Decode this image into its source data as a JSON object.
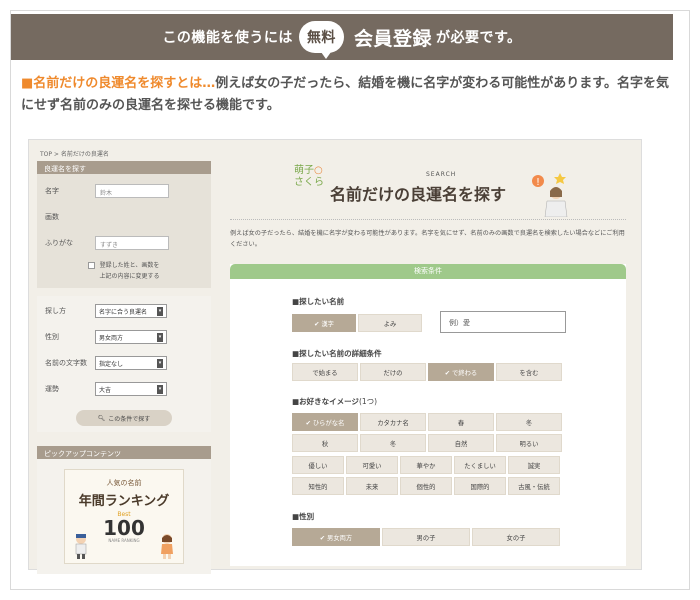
{
  "banner": {
    "prefix": "この機能を使うには",
    "bubble": "無料",
    "big": "会員登録",
    "suffix": "が必要です。"
  },
  "intro": {
    "highlight": "■名前だけの良運名を探すとは…",
    "text": "例えば女の子だったら、結婚を機に名字が変わる可能性があります。名字を気にせず名前のみの良運名を探せる機能です。"
  },
  "screenshot": {
    "breadcrumb": "TOP > 名前だけの良運名",
    "sidebar": {
      "header": "良運名を探す",
      "surname_label": "名字",
      "surname_value": "鈴木",
      "given_label": "画数",
      "kana_label": "ふりがな",
      "kana_placeholder": "すずき",
      "checkbox_text_1": "登録した姓と、画数を",
      "checkbox_text_2": "上記の内容に変更する",
      "method_label": "探し方",
      "method_value": "名字に合う良運名",
      "gender_label": "性別",
      "gender_value": "男女両方",
      "length_label": "名前の文字数",
      "length_value": "指定なし",
      "fortune_label": "運勢",
      "fortune_value": "大吉",
      "search_button": "この条件で探す",
      "pickup_header": "ピックアップコンテンツ",
      "ranking": {
        "line1": "人気の名前",
        "line2": "年間ランキング",
        "line3": "Best",
        "line4": "100",
        "line5": "NAME RANKING"
      }
    },
    "main": {
      "logo_text_1": "萌子",
      "logo_text_2": "さくら",
      "search_label": "SEARCH",
      "title": "名前だけの良運名を探す",
      "description": "例えば女の子だったら、結婚を機に名字が変わる可能性があります。名字を気にせず、名前のみの画数で良運名を検索したい場合などにご利用ください。",
      "conditions_header": "検索条件",
      "section1_title": "■探したい名前",
      "section1_options": [
        "✔ 漢字",
        "よみ"
      ],
      "section1_input_placeholder": "例）愛",
      "section2_title": "■探したい名前の詳細条件",
      "section2_options": [
        "で始まる",
        "だけの",
        "✔ で終わる",
        "を含む"
      ],
      "section3_title": "■お好きなイメージ",
      "section3_title_suffix": "(1つ)",
      "images_row1": [
        "✔ ひらがな名",
        "カタカナ名",
        "春",
        "冬"
      ],
      "images_row2": [
        "秋",
        "冬",
        "自然",
        "明るい"
      ],
      "images_row3": [
        "優しい",
        "可愛い",
        "華やか",
        "たくましい",
        "誠実"
      ],
      "images_row4": [
        "知性的",
        "未来",
        "個性的",
        "国際的",
        "古風・伝統"
      ],
      "section4_title": "■性別",
      "section4_options": [
        "✔ 男女両方",
        "男の子",
        "女の子"
      ]
    }
  }
}
